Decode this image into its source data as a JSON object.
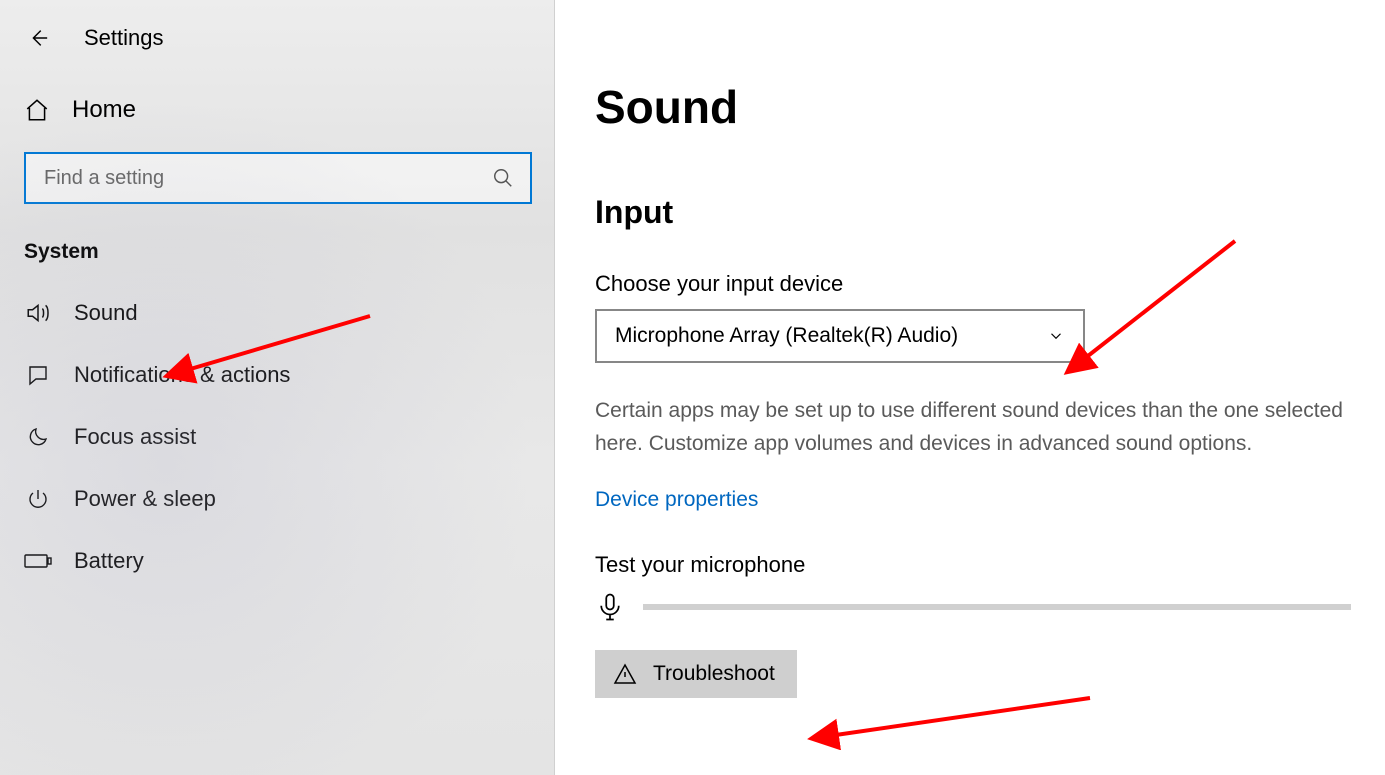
{
  "header": {
    "title": "Settings"
  },
  "sidebar": {
    "home_label": "Home",
    "search_placeholder": "Find a setting",
    "category_label": "System",
    "items": [
      {
        "label": "Sound",
        "icon": "speaker"
      },
      {
        "label": "Notifications & actions",
        "icon": "chat"
      },
      {
        "label": "Focus assist",
        "icon": "moon"
      },
      {
        "label": "Power & sleep",
        "icon": "power"
      },
      {
        "label": "Battery",
        "icon": "battery"
      }
    ]
  },
  "main": {
    "page_title": "Sound",
    "section_title": "Input",
    "input_label": "Choose your input device",
    "input_device": "Microphone Array (Realtek(R) Audio)",
    "description": "Certain apps may be set up to use different sound devices than the one selected here. Customize app volumes and devices in advanced sound options.",
    "device_properties_link": "Device properties",
    "test_label": "Test your microphone",
    "troubleshoot_label": "Troubleshoot"
  }
}
